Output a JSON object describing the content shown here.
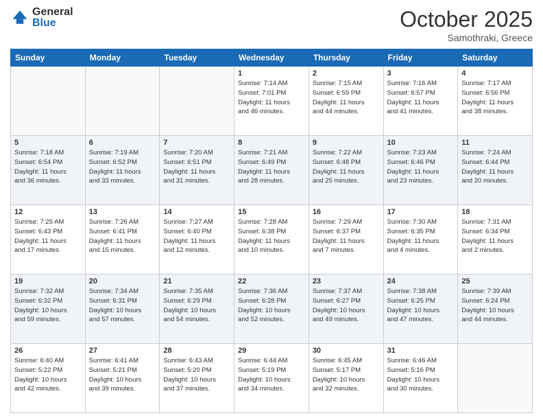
{
  "header": {
    "logo_general": "General",
    "logo_blue": "Blue",
    "title": "October 2025",
    "location": "Samothraki, Greece"
  },
  "days_of_week": [
    "Sunday",
    "Monday",
    "Tuesday",
    "Wednesday",
    "Thursday",
    "Friday",
    "Saturday"
  ],
  "weeks": [
    [
      {
        "num": "",
        "info": ""
      },
      {
        "num": "",
        "info": ""
      },
      {
        "num": "",
        "info": ""
      },
      {
        "num": "1",
        "info": "Sunrise: 7:14 AM\nSunset: 7:01 PM\nDaylight: 11 hours\nand 46 minutes."
      },
      {
        "num": "2",
        "info": "Sunrise: 7:15 AM\nSunset: 6:59 PM\nDaylight: 11 hours\nand 44 minutes."
      },
      {
        "num": "3",
        "info": "Sunrise: 7:16 AM\nSunset: 6:57 PM\nDaylight: 11 hours\nand 41 minutes."
      },
      {
        "num": "4",
        "info": "Sunrise: 7:17 AM\nSunset: 6:56 PM\nDaylight: 11 hours\nand 38 minutes."
      }
    ],
    [
      {
        "num": "5",
        "info": "Sunrise: 7:18 AM\nSunset: 6:54 PM\nDaylight: 11 hours\nand 36 minutes."
      },
      {
        "num": "6",
        "info": "Sunrise: 7:19 AM\nSunset: 6:52 PM\nDaylight: 11 hours\nand 33 minutes."
      },
      {
        "num": "7",
        "info": "Sunrise: 7:20 AM\nSunset: 6:51 PM\nDaylight: 11 hours\nand 31 minutes."
      },
      {
        "num": "8",
        "info": "Sunrise: 7:21 AM\nSunset: 6:49 PM\nDaylight: 11 hours\nand 28 minutes."
      },
      {
        "num": "9",
        "info": "Sunrise: 7:22 AM\nSunset: 6:48 PM\nDaylight: 11 hours\nand 25 minutes."
      },
      {
        "num": "10",
        "info": "Sunrise: 7:23 AM\nSunset: 6:46 PM\nDaylight: 11 hours\nand 23 minutes."
      },
      {
        "num": "11",
        "info": "Sunrise: 7:24 AM\nSunset: 6:44 PM\nDaylight: 11 hours\nand 20 minutes."
      }
    ],
    [
      {
        "num": "12",
        "info": "Sunrise: 7:25 AM\nSunset: 6:43 PM\nDaylight: 11 hours\nand 17 minutes."
      },
      {
        "num": "13",
        "info": "Sunrise: 7:26 AM\nSunset: 6:41 PM\nDaylight: 11 hours\nand 15 minutes."
      },
      {
        "num": "14",
        "info": "Sunrise: 7:27 AM\nSunset: 6:40 PM\nDaylight: 11 hours\nand 12 minutes."
      },
      {
        "num": "15",
        "info": "Sunrise: 7:28 AM\nSunset: 6:38 PM\nDaylight: 11 hours\nand 10 minutes."
      },
      {
        "num": "16",
        "info": "Sunrise: 7:29 AM\nSunset: 6:37 PM\nDaylight: 11 hours\nand 7 minutes."
      },
      {
        "num": "17",
        "info": "Sunrise: 7:30 AM\nSunset: 6:35 PM\nDaylight: 11 hours\nand 4 minutes."
      },
      {
        "num": "18",
        "info": "Sunrise: 7:31 AM\nSunset: 6:34 PM\nDaylight: 11 hours\nand 2 minutes."
      }
    ],
    [
      {
        "num": "19",
        "info": "Sunrise: 7:32 AM\nSunset: 6:32 PM\nDaylight: 10 hours\nand 59 minutes."
      },
      {
        "num": "20",
        "info": "Sunrise: 7:34 AM\nSunset: 6:31 PM\nDaylight: 10 hours\nand 57 minutes."
      },
      {
        "num": "21",
        "info": "Sunrise: 7:35 AM\nSunset: 6:29 PM\nDaylight: 10 hours\nand 54 minutes."
      },
      {
        "num": "22",
        "info": "Sunrise: 7:36 AM\nSunset: 6:28 PM\nDaylight: 10 hours\nand 52 minutes."
      },
      {
        "num": "23",
        "info": "Sunrise: 7:37 AM\nSunset: 6:27 PM\nDaylight: 10 hours\nand 49 minutes."
      },
      {
        "num": "24",
        "info": "Sunrise: 7:38 AM\nSunset: 6:25 PM\nDaylight: 10 hours\nand 47 minutes."
      },
      {
        "num": "25",
        "info": "Sunrise: 7:39 AM\nSunset: 6:24 PM\nDaylight: 10 hours\nand 44 minutes."
      }
    ],
    [
      {
        "num": "26",
        "info": "Sunrise: 6:40 AM\nSunset: 5:22 PM\nDaylight: 10 hours\nand 42 minutes."
      },
      {
        "num": "27",
        "info": "Sunrise: 6:41 AM\nSunset: 5:21 PM\nDaylight: 10 hours\nand 39 minutes."
      },
      {
        "num": "28",
        "info": "Sunrise: 6:43 AM\nSunset: 5:20 PM\nDaylight: 10 hours\nand 37 minutes."
      },
      {
        "num": "29",
        "info": "Sunrise: 6:44 AM\nSunset: 5:19 PM\nDaylight: 10 hours\nand 34 minutes."
      },
      {
        "num": "30",
        "info": "Sunrise: 6:45 AM\nSunset: 5:17 PM\nDaylight: 10 hours\nand 32 minutes."
      },
      {
        "num": "31",
        "info": "Sunrise: 6:46 AM\nSunset: 5:16 PM\nDaylight: 10 hours\nand 30 minutes."
      },
      {
        "num": "",
        "info": ""
      }
    ]
  ]
}
